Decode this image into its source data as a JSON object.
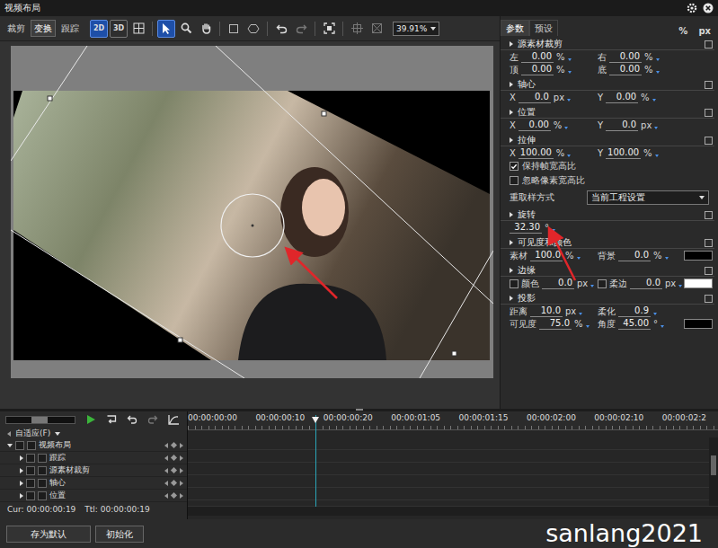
{
  "window": {
    "title": "视频布局"
  },
  "left_tabs": [
    {
      "label": "裁剪",
      "selected": false
    },
    {
      "label": "变换",
      "selected": true
    },
    {
      "label": "跟踪",
      "selected": false
    }
  ],
  "toolbar": {
    "mode_buttons": [
      {
        "label": "2D",
        "selected": true
      },
      {
        "label": "3D",
        "selected": false
      }
    ],
    "zoom": "39.91%"
  },
  "right_tabs": [
    {
      "label": "参数",
      "selected": true
    },
    {
      "label": "预设",
      "selected": false
    }
  ],
  "units": [
    "%",
    "px"
  ],
  "sections": [
    {
      "title": "源素材裁剪",
      "rows": [
        {
          "kind": "fields",
          "fields": [
            {
              "label": "左",
              "value": "0.00",
              "unit": "%"
            },
            {
              "label": "右",
              "value": "0.00",
              "unit": "%"
            }
          ]
        },
        {
          "kind": "fields",
          "fields": [
            {
              "label": "顶",
              "value": "0.00",
              "unit": "%"
            },
            {
              "label": "底",
              "value": "0.00",
              "unit": "%"
            }
          ]
        }
      ]
    },
    {
      "title": "轴心",
      "rows": [
        {
          "kind": "fields",
          "fields": [
            {
              "label": "X",
              "value": "0.0",
              "unit": "px"
            },
            {
              "label": "Y",
              "value": "0.00",
              "unit": "%"
            }
          ]
        }
      ]
    },
    {
      "title": "位置",
      "rows": [
        {
          "kind": "fields",
          "fields": [
            {
              "label": "X",
              "value": "0.00",
              "unit": "%"
            },
            {
              "label": "Y",
              "value": "0.0",
              "unit": "px"
            }
          ]
        }
      ]
    },
    {
      "title": "拉伸",
      "rows": [
        {
          "kind": "fields",
          "fields": [
            {
              "label": "X",
              "value": "100.00",
              "unit": "%"
            },
            {
              "label": "Y",
              "value": "100.00",
              "unit": "%"
            }
          ]
        },
        {
          "kind": "check",
          "label": "保持帧宽高比",
          "checked": true
        },
        {
          "kind": "check",
          "label": "忽略像素宽高比",
          "checked": false
        },
        {
          "kind": "select",
          "label": "重取样方式",
          "value": "当前工程设置"
        }
      ]
    },
    {
      "title": "旋转",
      "rows": [
        {
          "kind": "fields",
          "fields": [
            {
              "label": "",
              "value": "32.30",
              "unit": "°"
            }
          ]
        }
      ]
    },
    {
      "title": "可见度和颜色",
      "rows": [
        {
          "kind": "fields",
          "fields": [
            {
              "label": "素材",
              "value": "100.0",
              "unit": "%"
            },
            {
              "label": "背景",
              "value": "0.0",
              "unit": "%"
            }
          ],
          "swatch": "#000000"
        }
      ]
    },
    {
      "title": "边缘",
      "rows": [
        {
          "kind": "fields",
          "fields": [
            {
              "label": "颜色",
              "value": "0.0",
              "unit": "px",
              "checked": false
            },
            {
              "label": "柔边",
              "value": "0.0",
              "unit": "px",
              "checked": false
            }
          ],
          "swatch": "#ffffff"
        }
      ]
    },
    {
      "title": "投影",
      "rows": [
        {
          "kind": "fields",
          "fields": [
            {
              "label": "距离",
              "value": "10.0",
              "unit": "px"
            },
            {
              "label": "柔化",
              "value": "0.9",
              "unit": ""
            }
          ]
        },
        {
          "kind": "fields",
          "fields": [
            {
              "label": "可见度",
              "value": "75.0",
              "unit": "%"
            },
            {
              "label": "角度",
              "value": "45.00",
              "unit": "°"
            }
          ],
          "swatch": "#000000"
        }
      ]
    }
  ],
  "timeline": {
    "zoom_mode": "自适应(F)",
    "root": {
      "label": "视频布局",
      "expanded": true
    },
    "tracks": [
      {
        "label": "跟踪",
        "expanded": false
      },
      {
        "label": "源素材裁剪",
        "expanded": false
      },
      {
        "label": "轴心",
        "expanded": false
      },
      {
        "label": "位置",
        "expanded": false
      }
    ],
    "cur": "Cur: 00:00:00:19",
    "ttl": "Ttl: 00:00:00:19",
    "ruler": [
      "00:00:00:00",
      "00:00:00:10",
      "00:00:00:20",
      "00:00:01:05",
      "00:00:01:15",
      "00:00:02:00",
      "00:00:02:10",
      "00:00:02:2"
    ],
    "playhead": {
      "level": 0.24
    }
  },
  "buttons": [
    "存为默认",
    "初始化"
  ],
  "watermark": "sanlang2021"
}
